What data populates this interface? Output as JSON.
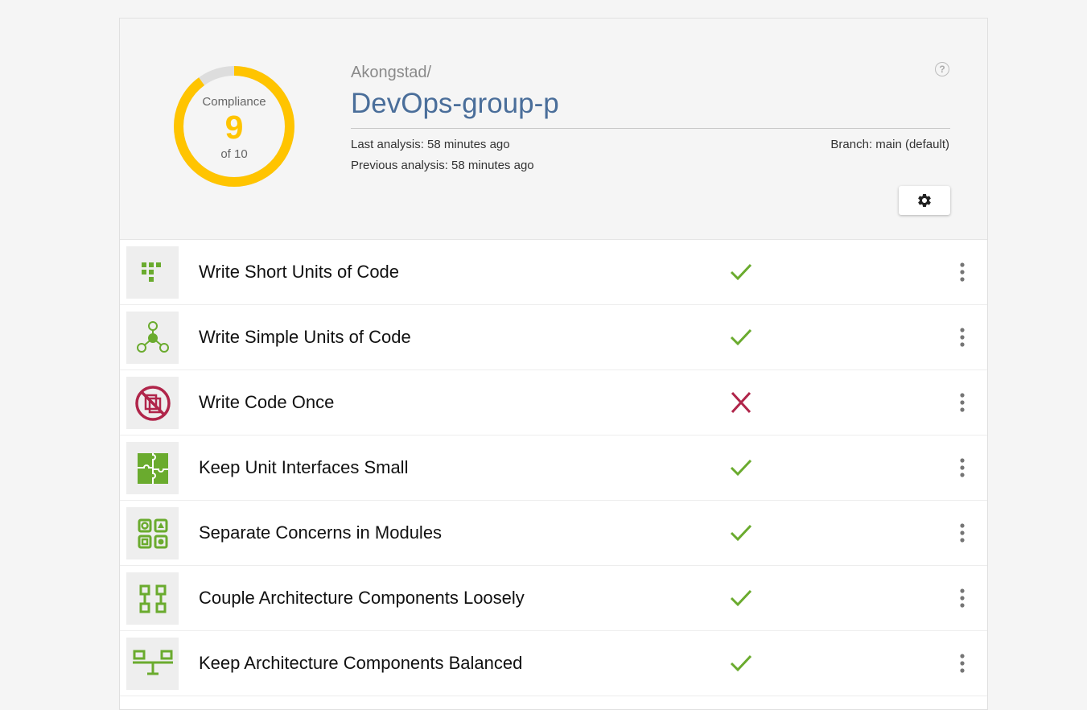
{
  "compliance": {
    "label": "Compliance",
    "score": "9",
    "of_text": "of 10",
    "score_value": 9,
    "max_value": 10,
    "ring_color": "#ffc400",
    "track_color": "#dddddd"
  },
  "repository": {
    "owner": "Akongstad/",
    "name": "DevOps-group-p",
    "last_analysis": "Last analysis: 58 minutes ago",
    "previous_analysis": "Previous analysis: 58 minutes ago",
    "branch": "Branch: main (default)"
  },
  "header_icons": {
    "help": "help-icon",
    "help_glyph": "?",
    "settings": "gear-icon"
  },
  "colors": {
    "pass": "#6aab2e",
    "fail": "#b0254a",
    "icon_green": "#6aab2e",
    "icon_red": "#b0254a"
  },
  "guidelines": [
    {
      "title": "Write Short Units of Code",
      "status": "pass",
      "icon": "short-units-icon"
    },
    {
      "title": "Write Simple Units of Code",
      "status": "pass",
      "icon": "simple-units-icon"
    },
    {
      "title": "Write Code Once",
      "status": "fail",
      "icon": "no-duplication-icon"
    },
    {
      "title": "Keep Unit Interfaces Small",
      "status": "pass",
      "icon": "puzzle-icon"
    },
    {
      "title": "Separate Concerns in Modules",
      "status": "pass",
      "icon": "modules-icon"
    },
    {
      "title": "Couple Architecture Components Loosely",
      "status": "pass",
      "icon": "loose-coupling-icon"
    },
    {
      "title": "Keep Architecture Components Balanced",
      "status": "pass",
      "icon": "balance-icon"
    }
  ]
}
